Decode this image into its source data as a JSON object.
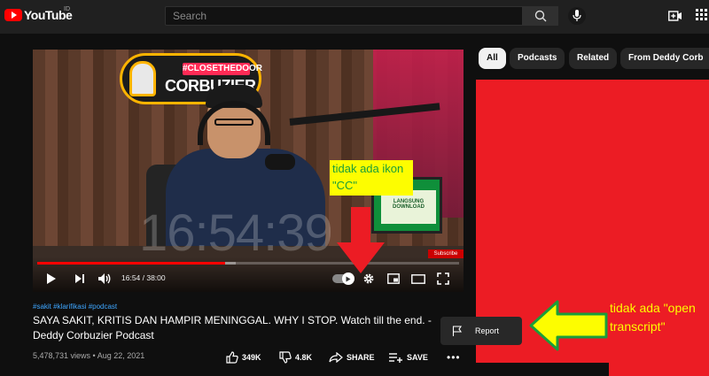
{
  "header": {
    "logo_text": "YouTube",
    "country_code": "ID",
    "search_placeholder": "Search",
    "icons": [
      "search-icon",
      "microphone-icon",
      "create-video-icon",
      "apps-icon"
    ]
  },
  "player": {
    "clock_overlay": "16:54:39",
    "sign_tag": "#CLOSETHEDOOR",
    "sign_title": "CORBUZIER",
    "ad_text": "LANGSUNG DOWNLOAD",
    "subscribe_badge": "Subscribe",
    "current_time": "16:54",
    "duration": "38:00",
    "time_display": "16:54 / 38:00",
    "progress_fraction": 0.445,
    "buffer_fraction": 0.47,
    "autoplay_on": true
  },
  "video": {
    "hashtags": "#sakit #klarifikasi #podcast",
    "title": "SAYA SAKIT, KRITIS DAN HAMPIR MENINGGAL. WHY I STOP. Watch till the end. - Deddy Corbuzier Podcast",
    "meta": "5,478,731 views • Aug 22, 2021"
  },
  "actions": {
    "like_count": "349K",
    "dislike_count": "4.8K",
    "share_label": "SHARE",
    "save_label": "SAVE"
  },
  "chips": [
    "All",
    "Podcasts",
    "Related",
    "From Deddy Corb"
  ],
  "menu": {
    "report_label": "Report"
  },
  "annotations": {
    "cc_note": "tidak ada ikon \"CC\"",
    "transcript_note": "tidak ada \"open transcript\"",
    "arrow_color": "#ec1c24",
    "yellow": "#fdfd00",
    "green": "#1a9e3a"
  },
  "colors": {
    "accent_red": "#ff0000",
    "link_blue": "#3ea6ff",
    "bg": "#0f0f0f"
  }
}
